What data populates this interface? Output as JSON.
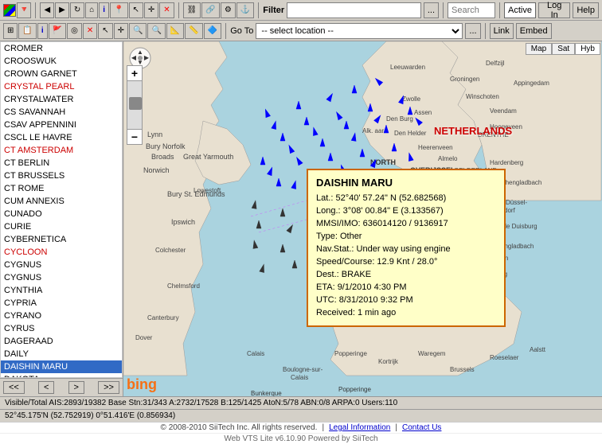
{
  "app": {
    "title": "Web VTS Lite v6.10.90"
  },
  "toolbar1": {
    "filter_label": "Filter",
    "filter_value": "",
    "search_placeholder": "Search",
    "search_value": "",
    "active_label": "Active",
    "login_label": "Log In",
    "help_label": "Help"
  },
  "toolbar2": {
    "goto_label": "Go To",
    "location_placeholder": "-- select location --",
    "location_value": "",
    "link_label": "Link",
    "embed_label": "Embed"
  },
  "map_tabs": {
    "map_label": "Map",
    "satellite_label": "Sat",
    "hybrid_label": "Hyb"
  },
  "vessel_list": {
    "items": [
      {
        "name": "CROMER",
        "type": "normal"
      },
      {
        "name": "CROOSWUK",
        "type": "normal"
      },
      {
        "name": "CROWN GARNET",
        "type": "normal"
      },
      {
        "name": "CRYSTAL PEARL",
        "type": "red"
      },
      {
        "name": "CRYSTALWATER",
        "type": "normal"
      },
      {
        "name": "CS SAVANNAH",
        "type": "normal"
      },
      {
        "name": "CSAV APPENNINI",
        "type": "normal"
      },
      {
        "name": "CSCL LE HAVRE",
        "type": "normal"
      },
      {
        "name": "CT AMSTERDAM",
        "type": "red"
      },
      {
        "name": "CT BERLIN",
        "type": "normal"
      },
      {
        "name": "CT BRUSSELS",
        "type": "normal"
      },
      {
        "name": "CT ROME",
        "type": "normal"
      },
      {
        "name": "CUM ANNEXIS",
        "type": "normal"
      },
      {
        "name": "CUNADO",
        "type": "normal"
      },
      {
        "name": "CURIE",
        "type": "normal"
      },
      {
        "name": "CYBERNETICA",
        "type": "normal"
      },
      {
        "name": "CYCLOON",
        "type": "red"
      },
      {
        "name": "CYGNUS",
        "type": "normal"
      },
      {
        "name": "CYGNUS",
        "type": "normal"
      },
      {
        "name": "CYNTHIA",
        "type": "normal"
      },
      {
        "name": "CYPRIA",
        "type": "normal"
      },
      {
        "name": "CYRANO",
        "type": "normal"
      },
      {
        "name": "CYRUS",
        "type": "normal"
      },
      {
        "name": "DAGERAAD",
        "type": "normal"
      },
      {
        "name": "DAILY",
        "type": "normal"
      },
      {
        "name": "DAISHIN MARU",
        "type": "selected"
      },
      {
        "name": "DAKOTA",
        "type": "normal"
      }
    ]
  },
  "sidebar_nav": {
    "prev_prev": "<<",
    "prev": "<",
    "next": ">",
    "next_next": ">>"
  },
  "vessel_info": {
    "name": "DAISHIN MARU",
    "lat": "Lat.: 52°40' 57.24\" N (52.682568)",
    "lng": "Long.: 3°08' 00.84\" E (3.133567)",
    "mmsi": "MMSI/IMO: 636014120 / 9136917",
    "type": "Type: Other",
    "nav_stat": "Nav.Stat.: Under way using engine",
    "speed": "Speed/Course: 12.9 Knt / 28.0°",
    "dest": "Dest.: BRAKE",
    "eta": "ETA: 9/1/2010 4:30 PM",
    "utc": "UTC: 8/31/2010 9:32 PM",
    "received": "Received: 1 min ago"
  },
  "status_bar": {
    "text": "Visible/Total AIS:2893/19382  Base Stn:31/343  A:2732/17528  B:125/1425  AtoN:5/78  ABN:0/8  ARPA:0  Users:110"
  },
  "coordinates": {
    "text": "52°45.175'N (52.752919)   0°51.416'E (0.856934)"
  },
  "footer": {
    "copyright": "© 2008-2010 SiiTech Inc. All rights reserved.",
    "legal_link": "Legal Information",
    "contact_link": "Contact Us",
    "version_text": "Web VTS Lite v6.10.90",
    "powered": "Powered by SiiTech"
  },
  "countries": {
    "netherlands": "NETHERLANDS"
  },
  "icons": {
    "zoom_in": "+",
    "zoom_out": "−",
    "pan_arrows": "⊕"
  }
}
